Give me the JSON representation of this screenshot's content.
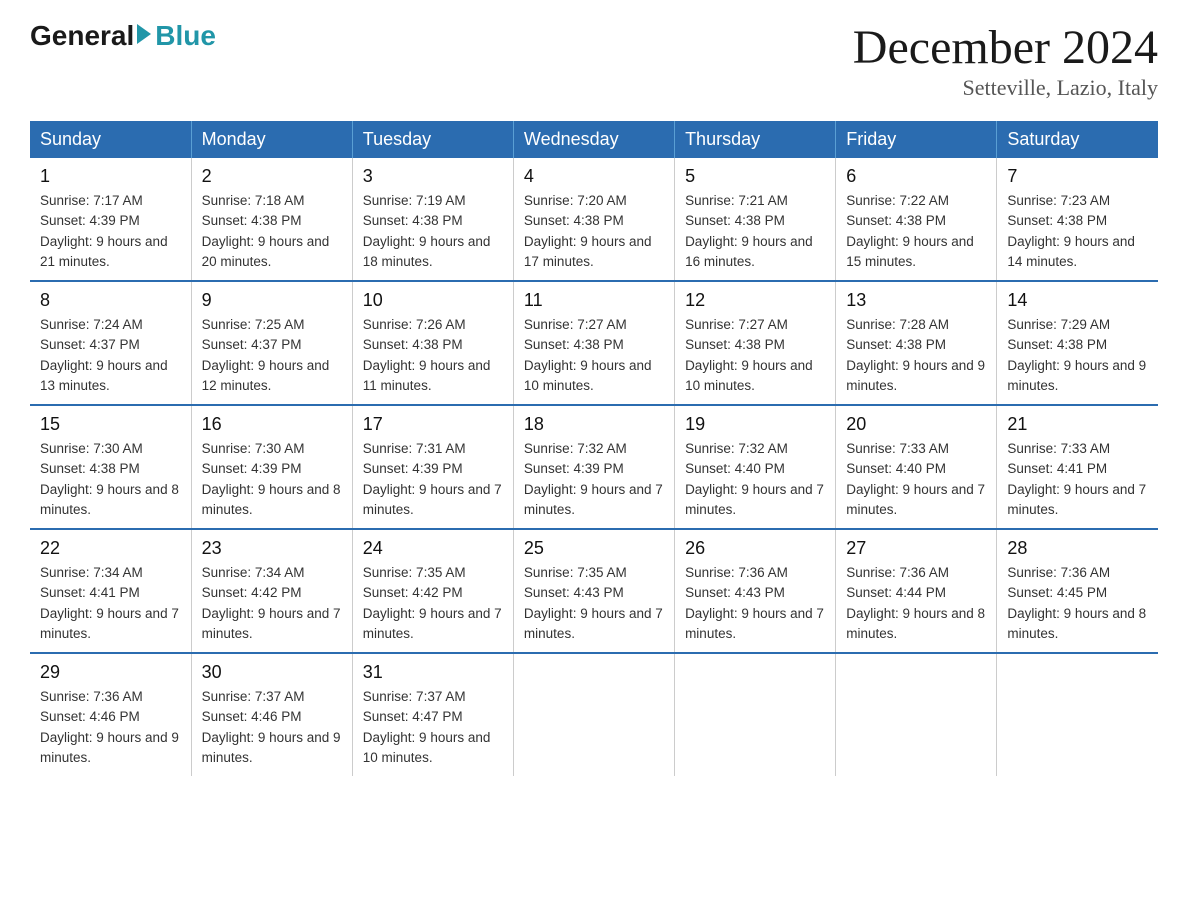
{
  "header": {
    "logo_general": "General",
    "logo_blue": "Blue",
    "month_title": "December 2024",
    "location": "Setteville, Lazio, Italy"
  },
  "days_of_week": [
    "Sunday",
    "Monday",
    "Tuesday",
    "Wednesday",
    "Thursday",
    "Friday",
    "Saturday"
  ],
  "weeks": [
    [
      {
        "day": "1",
        "sunrise": "7:17 AM",
        "sunset": "4:39 PM",
        "daylight": "9 hours and 21 minutes."
      },
      {
        "day": "2",
        "sunrise": "7:18 AM",
        "sunset": "4:38 PM",
        "daylight": "9 hours and 20 minutes."
      },
      {
        "day": "3",
        "sunrise": "7:19 AM",
        "sunset": "4:38 PM",
        "daylight": "9 hours and 18 minutes."
      },
      {
        "day": "4",
        "sunrise": "7:20 AM",
        "sunset": "4:38 PM",
        "daylight": "9 hours and 17 minutes."
      },
      {
        "day": "5",
        "sunrise": "7:21 AM",
        "sunset": "4:38 PM",
        "daylight": "9 hours and 16 minutes."
      },
      {
        "day": "6",
        "sunrise": "7:22 AM",
        "sunset": "4:38 PM",
        "daylight": "9 hours and 15 minutes."
      },
      {
        "day": "7",
        "sunrise": "7:23 AM",
        "sunset": "4:38 PM",
        "daylight": "9 hours and 14 minutes."
      }
    ],
    [
      {
        "day": "8",
        "sunrise": "7:24 AM",
        "sunset": "4:37 PM",
        "daylight": "9 hours and 13 minutes."
      },
      {
        "day": "9",
        "sunrise": "7:25 AM",
        "sunset": "4:37 PM",
        "daylight": "9 hours and 12 minutes."
      },
      {
        "day": "10",
        "sunrise": "7:26 AM",
        "sunset": "4:38 PM",
        "daylight": "9 hours and 11 minutes."
      },
      {
        "day": "11",
        "sunrise": "7:27 AM",
        "sunset": "4:38 PM",
        "daylight": "9 hours and 10 minutes."
      },
      {
        "day": "12",
        "sunrise": "7:27 AM",
        "sunset": "4:38 PM",
        "daylight": "9 hours and 10 minutes."
      },
      {
        "day": "13",
        "sunrise": "7:28 AM",
        "sunset": "4:38 PM",
        "daylight": "9 hours and 9 minutes."
      },
      {
        "day": "14",
        "sunrise": "7:29 AM",
        "sunset": "4:38 PM",
        "daylight": "9 hours and 9 minutes."
      }
    ],
    [
      {
        "day": "15",
        "sunrise": "7:30 AM",
        "sunset": "4:38 PM",
        "daylight": "9 hours and 8 minutes."
      },
      {
        "day": "16",
        "sunrise": "7:30 AM",
        "sunset": "4:39 PM",
        "daylight": "9 hours and 8 minutes."
      },
      {
        "day": "17",
        "sunrise": "7:31 AM",
        "sunset": "4:39 PM",
        "daylight": "9 hours and 7 minutes."
      },
      {
        "day": "18",
        "sunrise": "7:32 AM",
        "sunset": "4:39 PM",
        "daylight": "9 hours and 7 minutes."
      },
      {
        "day": "19",
        "sunrise": "7:32 AM",
        "sunset": "4:40 PM",
        "daylight": "9 hours and 7 minutes."
      },
      {
        "day": "20",
        "sunrise": "7:33 AM",
        "sunset": "4:40 PM",
        "daylight": "9 hours and 7 minutes."
      },
      {
        "day": "21",
        "sunrise": "7:33 AM",
        "sunset": "4:41 PM",
        "daylight": "9 hours and 7 minutes."
      }
    ],
    [
      {
        "day": "22",
        "sunrise": "7:34 AM",
        "sunset": "4:41 PM",
        "daylight": "9 hours and 7 minutes."
      },
      {
        "day": "23",
        "sunrise": "7:34 AM",
        "sunset": "4:42 PM",
        "daylight": "9 hours and 7 minutes."
      },
      {
        "day": "24",
        "sunrise": "7:35 AM",
        "sunset": "4:42 PM",
        "daylight": "9 hours and 7 minutes."
      },
      {
        "day": "25",
        "sunrise": "7:35 AM",
        "sunset": "4:43 PM",
        "daylight": "9 hours and 7 minutes."
      },
      {
        "day": "26",
        "sunrise": "7:36 AM",
        "sunset": "4:43 PM",
        "daylight": "9 hours and 7 minutes."
      },
      {
        "day": "27",
        "sunrise": "7:36 AM",
        "sunset": "4:44 PM",
        "daylight": "9 hours and 8 minutes."
      },
      {
        "day": "28",
        "sunrise": "7:36 AM",
        "sunset": "4:45 PM",
        "daylight": "9 hours and 8 minutes."
      }
    ],
    [
      {
        "day": "29",
        "sunrise": "7:36 AM",
        "sunset": "4:46 PM",
        "daylight": "9 hours and 9 minutes."
      },
      {
        "day": "30",
        "sunrise": "7:37 AM",
        "sunset": "4:46 PM",
        "daylight": "9 hours and 9 minutes."
      },
      {
        "day": "31",
        "sunrise": "7:37 AM",
        "sunset": "4:47 PM",
        "daylight": "9 hours and 10 minutes."
      },
      null,
      null,
      null,
      null
    ]
  ]
}
